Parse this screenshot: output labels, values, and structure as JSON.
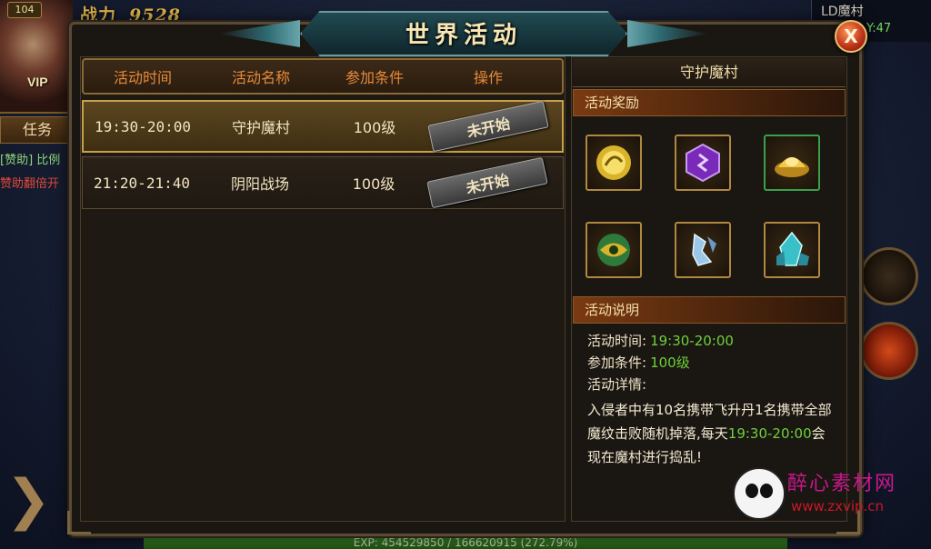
{
  "hud": {
    "level": "104",
    "vip": "VIP",
    "power_label": "战力",
    "power_value": "9528",
    "task_tab": "任务",
    "chat_line1": "[赞助] 比例",
    "chat_line2": "赞助翻倍开",
    "map_name": "LD魔村",
    "map_coord": "Y:47",
    "exp_text": "EXP: 454529850 / 166620915 (272.79%)",
    "exp_fill_fraction": 1.0
  },
  "dialog": {
    "title": "世界活动",
    "close_label": "X"
  },
  "list": {
    "headers": [
      "活动时间",
      "活动名称",
      "参加条件",
      "操作"
    ],
    "rows": [
      {
        "time": "19:30-20:00",
        "name": "守护魔村",
        "condition": "100级",
        "action": "未开始",
        "selected": true
      },
      {
        "time": "21:20-21:40",
        "name": "阴阳战场",
        "condition": "100级",
        "action": "未开始",
        "selected": false
      }
    ]
  },
  "detail": {
    "title": "守护魔村",
    "rewards_header": "活动奖励",
    "rewards": [
      {
        "icon": "gold-orb-icon",
        "border": "#b08840"
      },
      {
        "icon": "purple-gem-icon",
        "border": "#b08840"
      },
      {
        "icon": "gold-ingot-icon",
        "border": "#3aa04a"
      },
      {
        "icon": "green-orb-icon",
        "border": "#b08840"
      },
      {
        "icon": "ice-fragment-icon",
        "border": "#b08840"
      },
      {
        "icon": "blue-crystal-icon",
        "border": "#b08840"
      }
    ],
    "desc_header": "活动说明",
    "time_label": "活动时间:",
    "time_value": "19:30-20:00",
    "cond_label": "参加条件:",
    "cond_value": "100级",
    "detail_label": "活动详情:",
    "body_part1": "入侵者中有10名携带飞升丹1名携带全部魔纹击败随机掉落,每天",
    "body_green": "19:30-20:00",
    "body_part2": "会现在魔村进行捣乱!"
  },
  "watermark": {
    "text": "醉心素材网",
    "url": "www.zxvip.cn"
  },
  "colors": {
    "header_text": "#e98a3a",
    "accent_green": "#6fd03a",
    "gold_border": "#c9a04a"
  }
}
